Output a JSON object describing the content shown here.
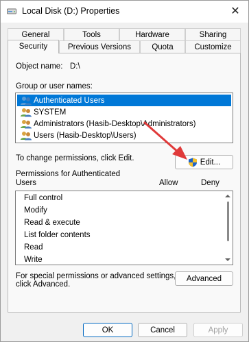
{
  "window": {
    "title": "Local Disk (D:) Properties",
    "close_glyph": "✕"
  },
  "tabs_back": [
    "General",
    "Tools",
    "Hardware",
    "Sharing"
  ],
  "tabs_front": [
    "Security",
    "Previous Versions",
    "Quota",
    "Customize"
  ],
  "active_tab": "Security",
  "object": {
    "label": "Object name:",
    "value": "D:\\"
  },
  "groups": {
    "label": "Group or user names:",
    "items": [
      {
        "label": "Authenticated Users",
        "selected": true
      },
      {
        "label": "SYSTEM",
        "selected": false
      },
      {
        "label": "Administrators (Hasib-Desktop\\Administrators)",
        "selected": false
      },
      {
        "label": "Users (Hasib-Desktop\\Users)",
        "selected": false
      }
    ]
  },
  "change_perm_text": "To change permissions, click Edit.",
  "edit_button": "Edit...",
  "permissions": {
    "header": "Permissions for Authenticated Users",
    "header_line1": "Permissions for Authenticated",
    "header_line2": "Users",
    "allow_label": "Allow",
    "deny_label": "Deny",
    "items": [
      "Full control",
      "Modify",
      "Read & execute",
      "List folder contents",
      "Read",
      "Write"
    ]
  },
  "advanced_text_line1": "For special permissions or advanced settings,",
  "advanced_text_line2": "click Advanced.",
  "advanced_button": "Advanced",
  "buttons": {
    "ok": "OK",
    "cancel": "Cancel",
    "apply": "Apply"
  },
  "colors": {
    "selection": "#0078d7",
    "annotation_arrow": "#e03a3a"
  }
}
